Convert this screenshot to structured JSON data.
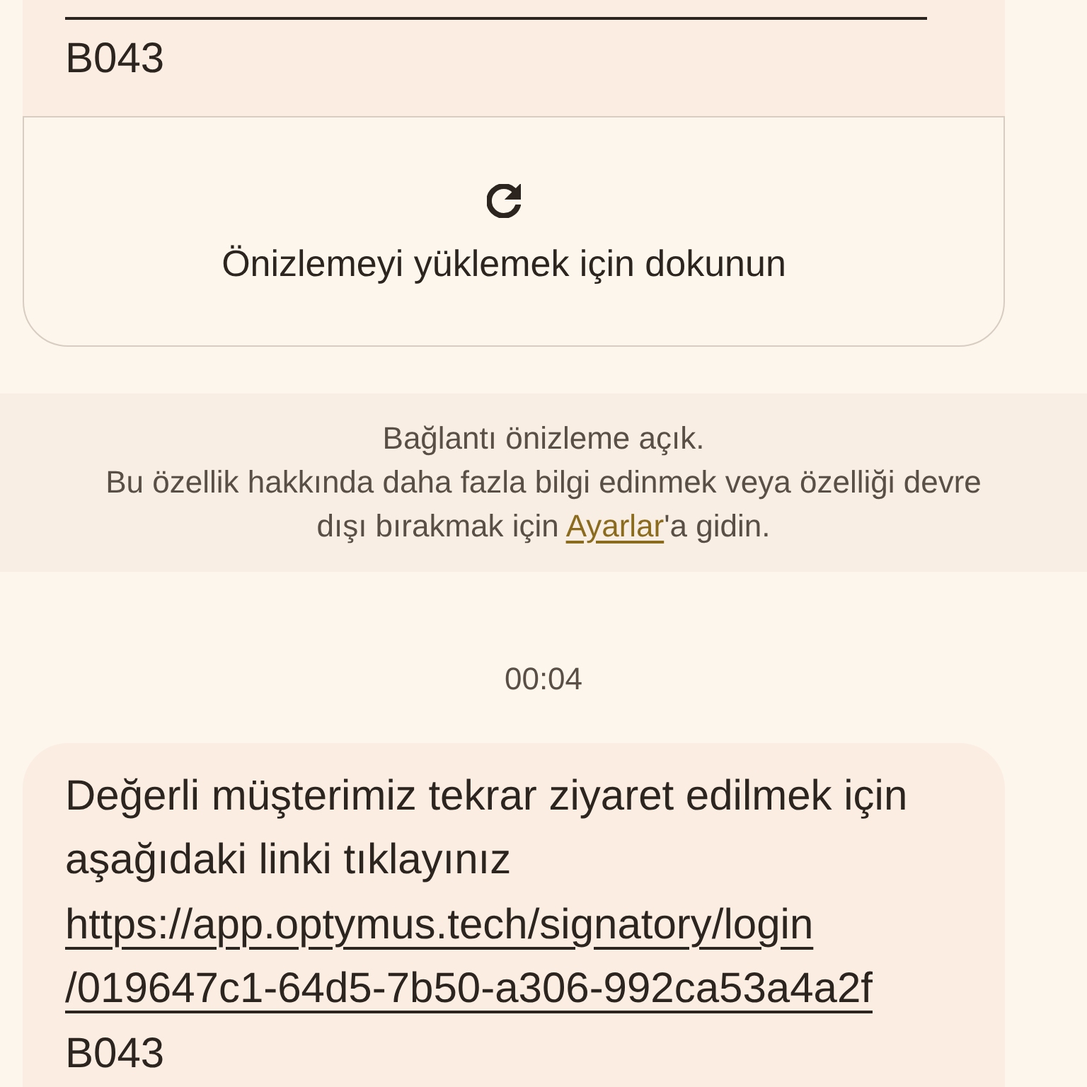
{
  "earlier_message": {
    "code": "B043",
    "preview_card": {
      "label": "Önizlemeyi yüklemek için dokunun"
    }
  },
  "link_preview_notice": {
    "title": "Bağlantı önizleme açık.",
    "text_before": "Bu özellik hakkında daha fazla bilgi edinmek veya özelliği devre dışı bırakmak için ",
    "settings_link": "Ayarlar",
    "text_after": "'a gidin."
  },
  "timestamp": "00:04",
  "message": {
    "text": "Değerli müşterimiz tekrar ziyaret edilmek için aşağıdaki linki tıklayınız",
    "link_lines": [
      "https://app.optymus.tech/signatory/login",
      "/019647c1-64d5-7b50-a306-992ca53a4a2f"
    ],
    "code": "B043"
  }
}
